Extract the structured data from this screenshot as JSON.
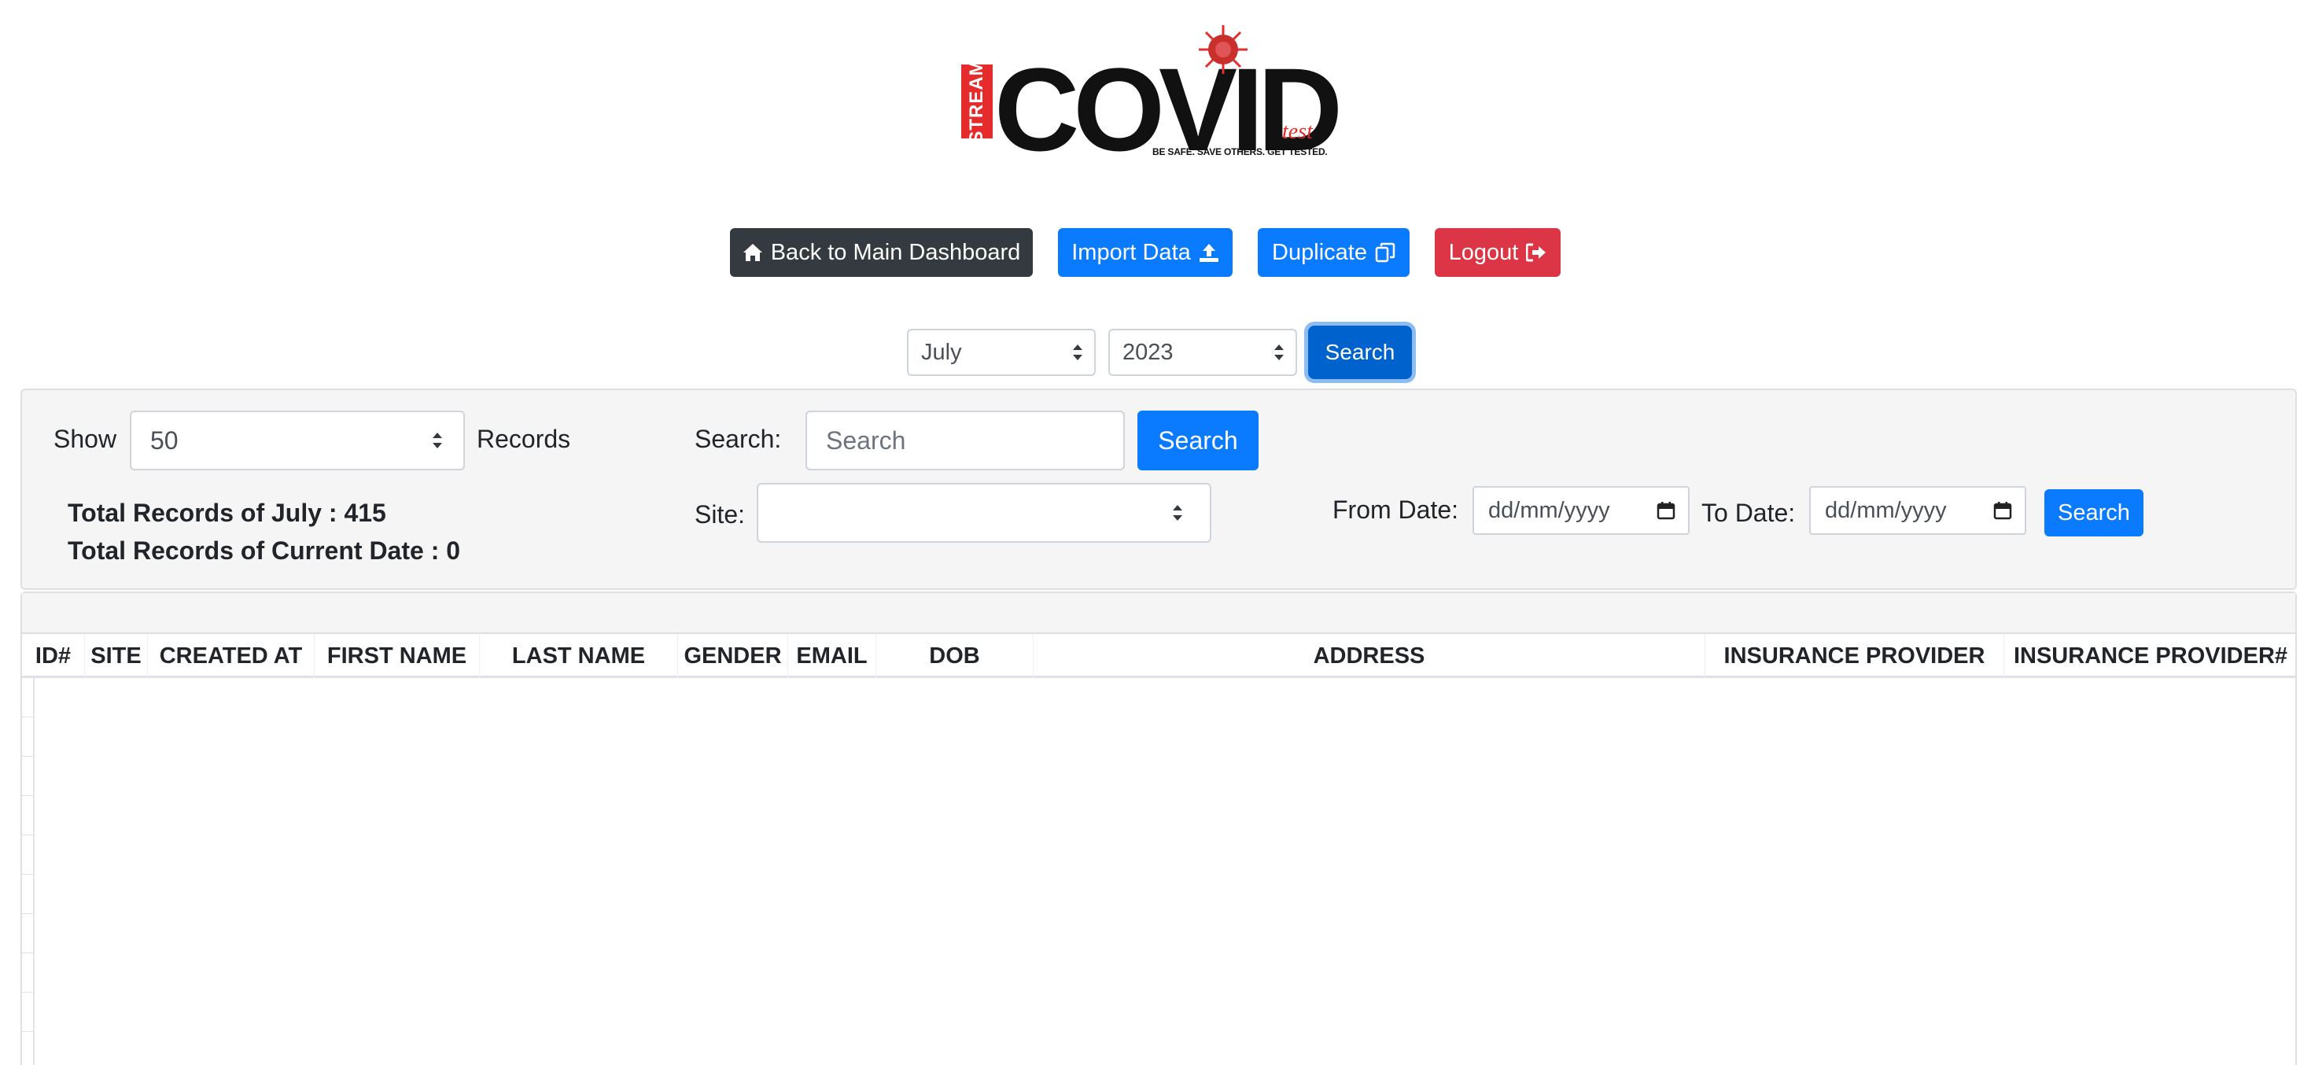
{
  "logo": {
    "stream": "STREAM",
    "covid": "COVID",
    "test": "test",
    "tagline": "BE SAFE. SAVE OTHERS. GET TESTED.",
    "brand_red": "#e52b2b"
  },
  "top_actions": {
    "back": {
      "label": "Back to Main Dashboard",
      "icon": "home-icon"
    },
    "import": {
      "label": "Import Data",
      "icon": "upload-icon"
    },
    "duplicate": {
      "label": "Duplicate",
      "icon": "copy-icon"
    },
    "logout": {
      "label": "Logout",
      "icon": "sign-out-icon"
    }
  },
  "period_filter": {
    "month": "July",
    "year": "2023",
    "search_label": "Search"
  },
  "filters": {
    "show_label": "Show",
    "show_value": "50",
    "records_label": "Records",
    "search_label": "Search:",
    "search_placeholder": "Search",
    "search_button": "Search",
    "site_label": "Site:",
    "site_value": "",
    "from_date_label": "From Date:",
    "from_date_placeholder": "dd/mm/yyyy",
    "to_date_label": "To Date:",
    "to_date_placeholder": "dd/mm/yyyy",
    "date_search_button": "Search",
    "total_month": "Total Records of July : 415",
    "total_current": "Total Records of Current Date : 0"
  },
  "table": {
    "columns": [
      "ID#",
      "SITE",
      "CREATED AT",
      "FIRST NAME",
      "LAST NAME",
      "GENDER",
      "EMAIL",
      "DOB",
      "ADDRESS",
      "INSURANCE PROVIDER",
      "INSURANCE PROVIDER#"
    ],
    "rows": []
  },
  "colors": {
    "primary": "#0a7bff",
    "dark": "#343a40",
    "danger": "#dc3545",
    "panel_bg": "#f5f5f5"
  }
}
